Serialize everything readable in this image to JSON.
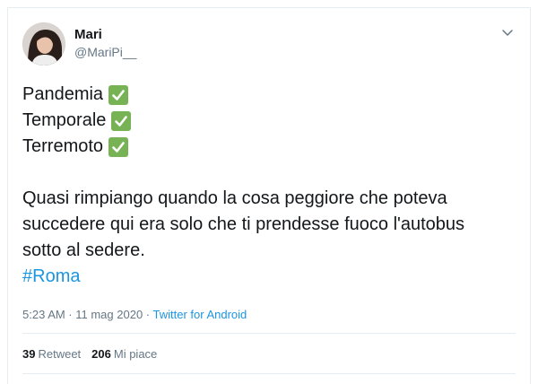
{
  "tweet": {
    "author_name": "Mari",
    "author_handle": "@MariPi__",
    "checklist": [
      "Pandemia",
      "Temporale",
      "Terremoto"
    ],
    "paragraph_lines": [
      "Quasi rimpiango quando la cosa peggiore che poteva",
      "succedere qui era solo che ti prendesse fuoco l'autobus",
      "sotto al sedere."
    ],
    "hashtag": "#Roma",
    "timestamp": "5:23 AM · 11 mag 2020 · ",
    "source": "Twitter for Android",
    "retweets_count": "39",
    "retweets_label": "Retweet",
    "likes_count": "206",
    "likes_label": "Mi piace"
  },
  "icons": {
    "menu": "chevron-down-icon",
    "check": "check-mark-icon"
  },
  "colors": {
    "link": "#1b95e0",
    "check_green": "#77b255",
    "secondary_text": "#657786"
  }
}
